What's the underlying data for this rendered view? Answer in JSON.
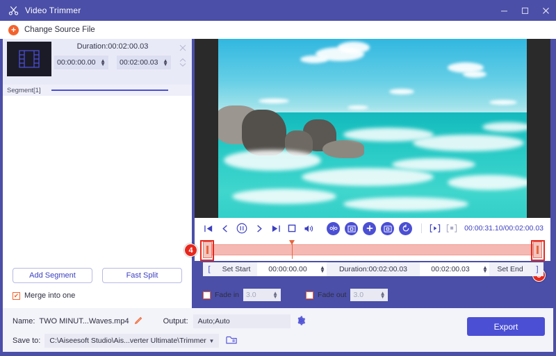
{
  "window": {
    "title": "Video Trimmer",
    "logo_icon": "scissors-icon",
    "minimize_icon": "minimize-icon",
    "maximize_icon": "maximize-icon",
    "close_icon": "close-icon"
  },
  "source_bar": {
    "plus_icon": "plus-circle-icon",
    "label": "Change Source File"
  },
  "segment": {
    "thumbnail_icon": "film-strip-icon",
    "duration_label": "Duration:00:02:00.03",
    "start_time": "00:00:00.00",
    "end_time": "00:02:00.03",
    "close_icon": "close-icon",
    "expand_icon": "expand-collapse-icon",
    "footer_label": "Segment[1]"
  },
  "left_buttons": {
    "add_segment": "Add Segment",
    "fast_split": "Fast Split"
  },
  "merge": {
    "label": "Merge into one",
    "checked": true,
    "check_glyph": "✔"
  },
  "player_controls": {
    "icons": [
      "jump-to-start-icon",
      "previous-frame-icon",
      "pause-icon",
      "next-frame-icon",
      "jump-to-end-icon",
      "stop-icon",
      "volume-icon"
    ],
    "round_buttons": [
      "split-clip-icon",
      "snapshot-icon",
      "add-icon",
      "record-stop-icon",
      "reset-icon"
    ],
    "bracket_buttons": [
      "set-in-point-icon",
      "set-out-point-icon"
    ],
    "timecode": "00:00:31.10/00:02:00.03"
  },
  "set_row": {
    "start_bracket_icon": "left-bracket-icon",
    "set_start_label": "Set Start",
    "start_value": "00:00:00.00",
    "duration_label": "Duration:00:02:00.03",
    "end_value": "00:02:00.03",
    "set_end_label": "Set End",
    "end_bracket_icon": "right-bracket-icon"
  },
  "fade": {
    "fade_in_label": "Fade in",
    "fade_in_value": "3.0",
    "fade_in_checked": false,
    "fade_out_label": "Fade out",
    "fade_out_value": "3.0",
    "fade_out_checked": false
  },
  "markers": [
    {
      "number": "4",
      "target": "left-trim-handle"
    },
    {
      "number": "5",
      "target": "right-trim-handle"
    }
  ],
  "bottom": {
    "name_label": "Name:",
    "name_value": "TWO MINUT...Waves.mp4",
    "edit_icon": "pencil-icon",
    "output_label": "Output:",
    "output_value": "Auto;Auto",
    "settings_icon": "gear-icon",
    "save_to_label": "Save to:",
    "save_to_value": "C:\\Aiseesoft Studio\\Ais...verter Ultimate\\Trimmer",
    "dropdown_icon": "chevron-down-icon",
    "folder_icon": "folder-icon",
    "export_label": "Export"
  },
  "colors": {
    "titlebar": "#4b4fa8",
    "accent_blue": "#4b4fd4",
    "accent_orange": "#f4622c",
    "marker_red": "#e8271c",
    "timeline_pink": "#f6b8b2"
  }
}
